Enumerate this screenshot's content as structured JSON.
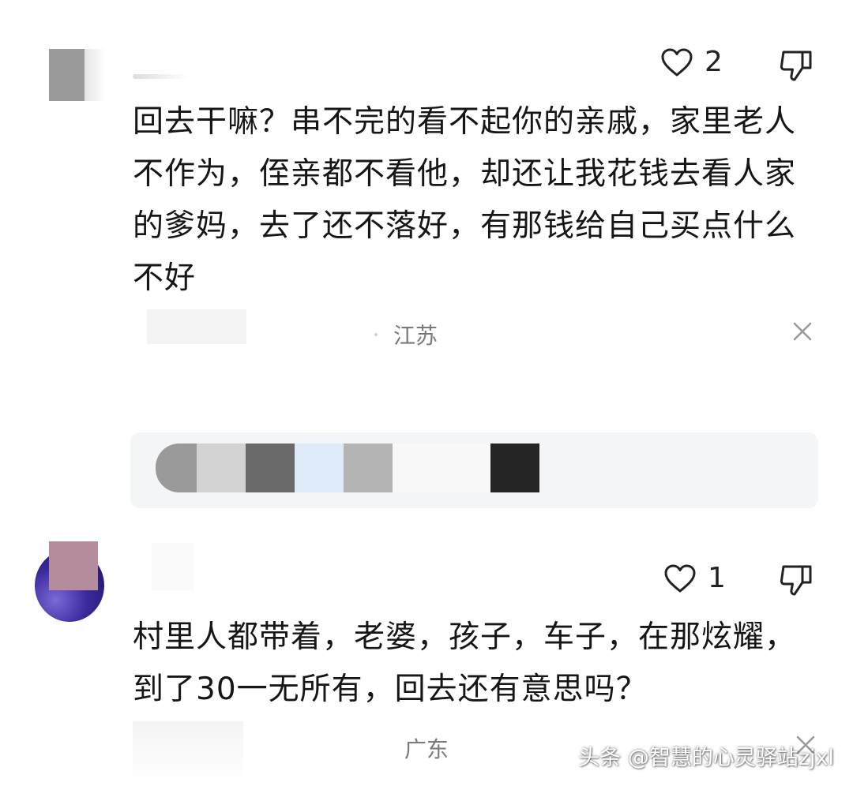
{
  "comments": [
    {
      "likes": "2",
      "text": "回去干嘛？串不完的看不起你的亲戚，家里老人不作为，侄亲都不看他，却还让我花钱去看人家的爹妈，去了还不落好，有那钱给自己买点什么不好",
      "location": "江苏"
    },
    {
      "likes": "1",
      "text": "村里人都带着，老婆，孩子，车子，在那炫耀，到了30一无所有，回去还有意思吗？",
      "location": "广东"
    }
  ],
  "reply_strip_colors": [
    "#9a9a9a",
    "#d2d2d2",
    "#6a6a6a",
    "#dfeaf8",
    "#b4b4b4",
    "#f8f8f8",
    "#252525"
  ],
  "watermark": "头条 @智慧的心灵驿站zjxl"
}
